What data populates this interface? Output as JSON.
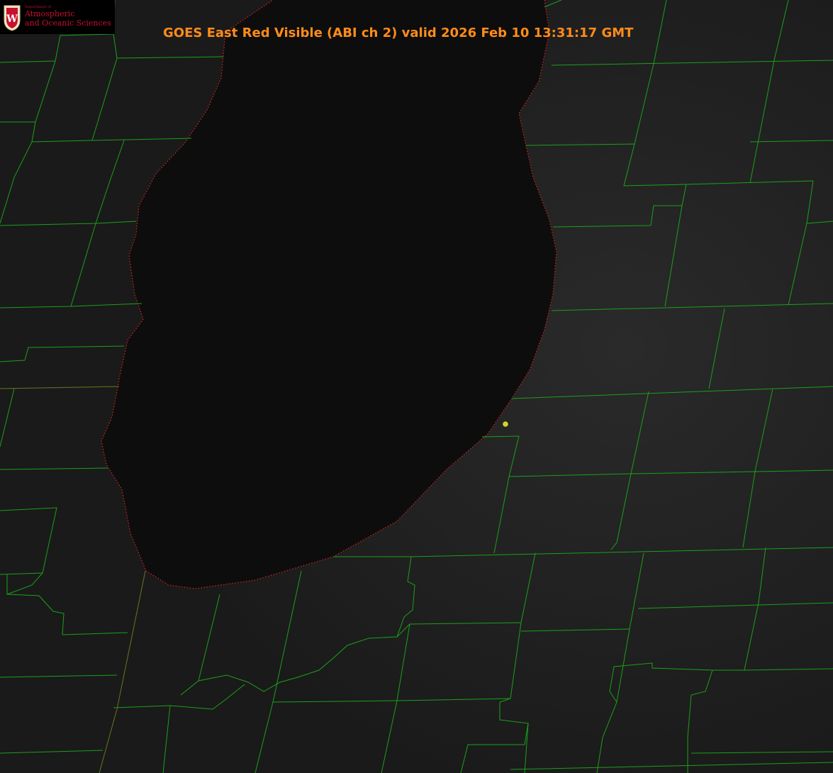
{
  "title": "GOES East Red Visible (ABI ch 2) valid 2026 Feb 10 13:31:17 GMT",
  "logo": {
    "department": "Department of",
    "line1": "Atmospheric",
    "line2": "and Oceanic Sciences",
    "seal_letter": "W"
  },
  "colors": {
    "background": "#1b1b1b",
    "lake": "#0c0c0c",
    "county_lines": "#1aa01a",
    "shoreline_dots": "#cc2222",
    "title": "#ff8c1a",
    "marker": "#d4d422",
    "logo_text": "#c8102e"
  },
  "marker": {
    "name": "station-marker"
  },
  "map": {
    "type": "satellite-visible-imagery",
    "features": [
      "lake",
      "county-boundaries",
      "state-boundary",
      "shoreline"
    ]
  }
}
